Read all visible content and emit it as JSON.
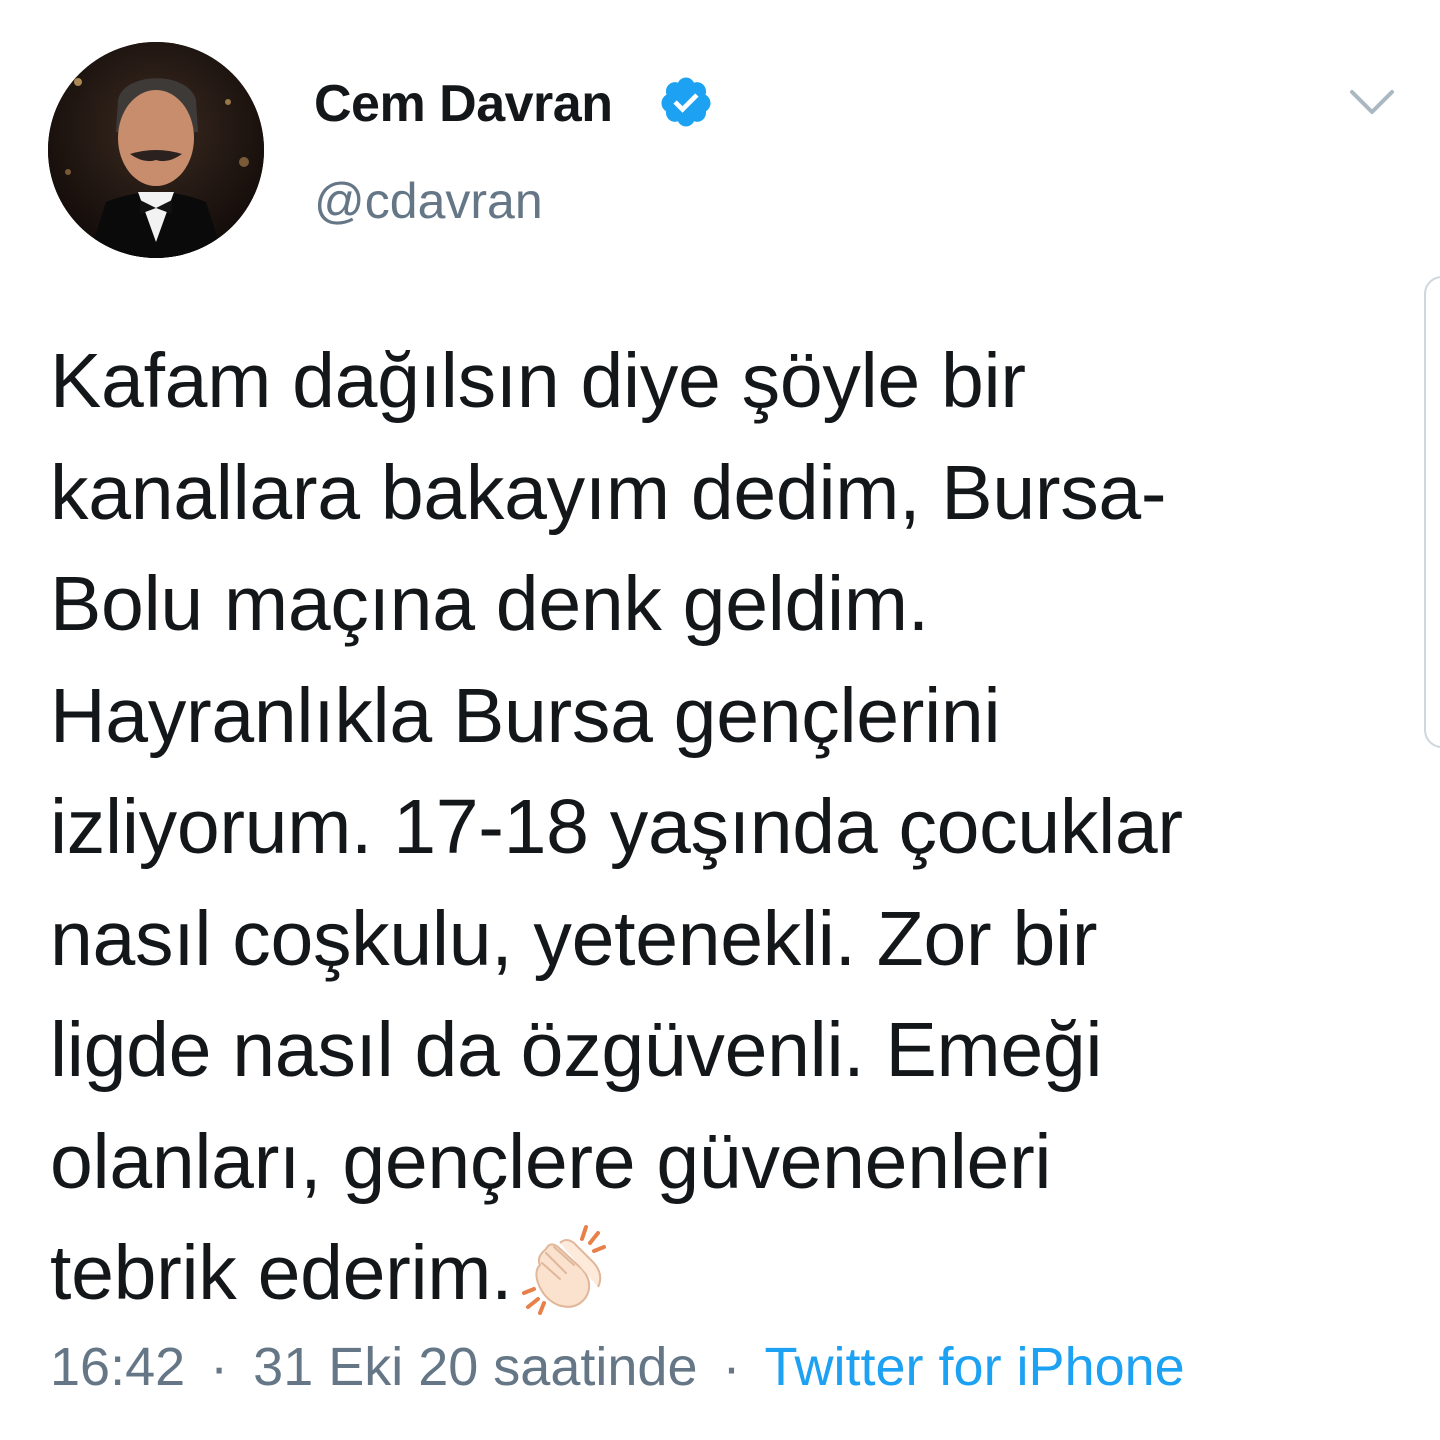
{
  "author": {
    "display_name": "Cem Davran",
    "handle": "@cdavran",
    "verified": true,
    "avatar_icon": "profile-photo"
  },
  "menu": {
    "icon": "chevron-down-icon"
  },
  "tweet": {
    "lines": [
      "Kafam dağılsın diye şöyle bir",
      "kanallara bakayım dedim, Bursa-",
      "Bolu maçına denk geldim.",
      "Hayranlıkla Bursa gençlerini",
      "izliyorum. 17-18 yaşında çocuklar",
      "nasıl coşkulu, yetenekli. Zor bir",
      "ligde nasıl da özgüvenli. Emeği",
      "olanları, gençlere güvenenleri",
      "tebrik ederim."
    ],
    "emoji": "clapping-hands-icon"
  },
  "meta": {
    "time": "16:42",
    "separator": "·",
    "date": "31 Eki 20 saatinde",
    "source": "Twitter for iPhone"
  },
  "colors": {
    "text": "#14171a",
    "secondary": "#657786",
    "link": "#1da1f2",
    "verified": "#1da1f2"
  }
}
